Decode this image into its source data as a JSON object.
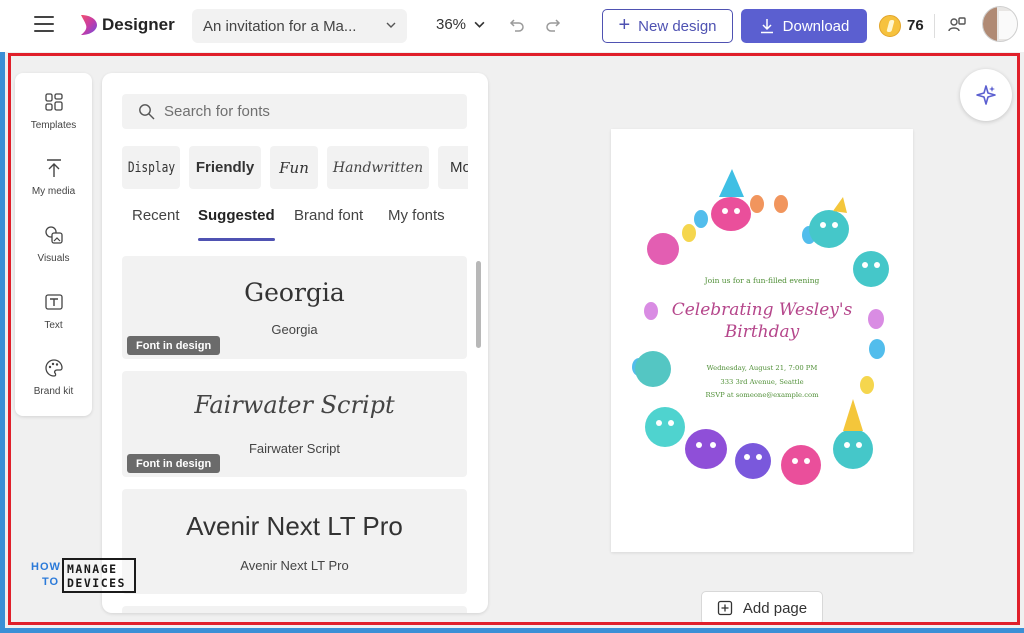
{
  "app": {
    "name": "Designer",
    "document_title": "An invitation for a Ma...",
    "zoom": "36%",
    "new_design_label": "New design",
    "download_label": "Download",
    "credits": "76",
    "accent_color": "#5b5fd0"
  },
  "rail": {
    "items": [
      {
        "label": "Templates",
        "icon": "templates-icon"
      },
      {
        "label": "My media",
        "icon": "upload-icon"
      },
      {
        "label": "Visuals",
        "icon": "visuals-icon"
      },
      {
        "label": "Text",
        "icon": "text-icon"
      },
      {
        "label": "Brand kit",
        "icon": "palette-icon"
      }
    ]
  },
  "fonts_panel": {
    "search_placeholder": "Search for fonts",
    "categories": [
      "Display",
      "Friendly",
      "Fun",
      "Handwritten",
      "Mo"
    ],
    "tabs": [
      "Recent",
      "Suggested",
      "Brand font",
      "My fonts"
    ],
    "active_tab": "Suggested",
    "fonts": [
      {
        "preview": "Georgia",
        "name": "Georgia",
        "badge": "Font in design"
      },
      {
        "preview": "Fairwater Script",
        "name": "Fairwater Script",
        "badge": "Font in design"
      },
      {
        "preview": "Avenir Next LT Pro",
        "name": "Avenir Next LT Pro",
        "badge": ""
      }
    ]
  },
  "canvas": {
    "invite_line": "Join us for a fun-filled evening",
    "invite_title_1": "Celebrating Wesley's",
    "invite_title_2": "Birthday",
    "details": [
      "Wednesday, August 21, 7:00 PM",
      "333 3rd Avenue, Seattle",
      "RSVP at someone@example.com"
    ],
    "add_page_label": "Add page"
  },
  "watermark": {
    "left_top": "HOW",
    "left_bottom": "TO",
    "box_top": "MANAGE",
    "box_bottom": "DEVICES"
  }
}
